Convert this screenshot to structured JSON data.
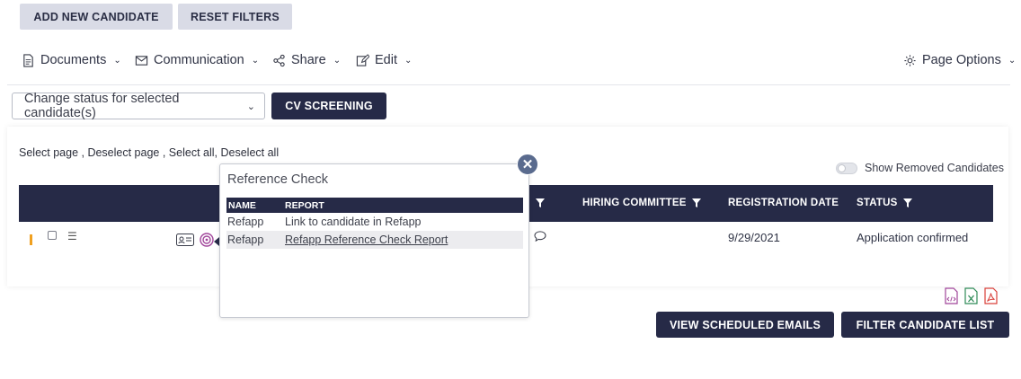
{
  "actions": {
    "add_candidate": "ADD NEW CANDIDATE",
    "reset_filters": "RESET FILTERS",
    "cv_screening": "CV SCREENING",
    "view_scheduled_emails": "VIEW SCHEDULED EMAILS",
    "filter_candidate_list": "FILTER CANDIDATE LIST"
  },
  "toolbar": {
    "documents": "Documents",
    "communication": "Communication",
    "share": "Share",
    "edit": "Edit",
    "page_options": "Page Options"
  },
  "status_select": {
    "value": "Change status for selected candidate(s)"
  },
  "selection": {
    "select_page": "Select page",
    "deselect_page": "Deselect page",
    "select_all": "Select all",
    "deselect_all": "Deselect all"
  },
  "show_removed_label": "Show Removed Candidates",
  "table": {
    "headers": {
      "hiring_committee": "HIRING COMMITTEE",
      "registration_date": "REGISTRATION DATE",
      "status": "STATUS"
    },
    "rows": [
      {
        "registration_date": "9/29/2021",
        "status": "Application confirmed"
      }
    ]
  },
  "popup": {
    "title": "Reference Check",
    "headers": [
      "NAME",
      "REPORT"
    ],
    "rows": [
      {
        "name": "Refapp",
        "report": "Link to candidate in Refapp"
      },
      {
        "name": "Refapp",
        "report": "Refapp Reference Check Report"
      }
    ],
    "close_glyph": "✕"
  },
  "colors": {
    "navy": "#262a47",
    "grey_button": "#d9dbe6",
    "accent_orange": "#f0a020",
    "pdf_red": "#d9403a",
    "excel_green": "#2e8b57",
    "xml_purple": "#a0459a"
  }
}
